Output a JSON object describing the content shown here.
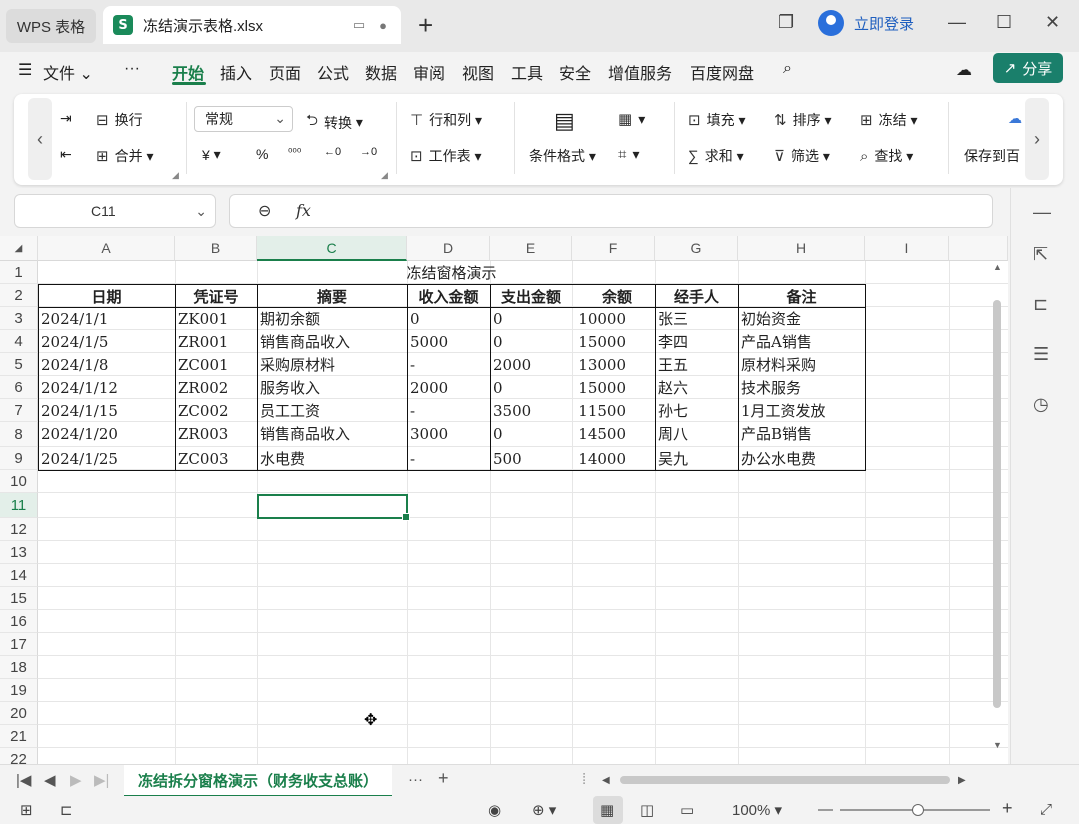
{
  "titlebar": {
    "app_tab": "WPS 表格",
    "file_tab": "冻结演示表格.xlsx",
    "login": "立即登录"
  },
  "menu": {
    "items": [
      "文件",
      "···",
      "开始",
      "插入",
      "页面",
      "公式",
      "数据",
      "审阅",
      "视图",
      "工具",
      "安全",
      "增值服务",
      "百度网盘"
    ],
    "active": "开始",
    "share": "分享"
  },
  "ribbon": {
    "wrap": "换行",
    "merge": "合并",
    "number_format": "常规",
    "convert": "转换",
    "currency": "¥",
    "percent": "%",
    "rows_cols": "行和列",
    "worksheet": "工作表",
    "cond_format": "条件格式",
    "fill": "填充",
    "sort": "排序",
    "freeze": "冻结",
    "sum": "求和",
    "filter": "筛选",
    "find": "查找",
    "save_baidu": "保存到百"
  },
  "formula_bar": {
    "cell_ref": "C11",
    "fx": "fx",
    "value": ""
  },
  "grid": {
    "columns": [
      "A",
      "B",
      "C",
      "D",
      "E",
      "F",
      "G",
      "H",
      "I"
    ],
    "rows": [
      "1",
      "2",
      "3",
      "4",
      "5",
      "6",
      "7",
      "8",
      "9",
      "10",
      "11",
      "12",
      "13",
      "14",
      "15",
      "16",
      "17",
      "18",
      "19",
      "20",
      "21",
      "22"
    ],
    "selected_cell": "C11",
    "title": "冻结窗格演示",
    "headers": [
      "日期",
      "凭证号",
      "摘要",
      "收入金额",
      "支出金额",
      "余额",
      "经手人",
      "备注"
    ],
    "data": [
      [
        "2024/1/1",
        "ZK001",
        "期初余额",
        "0",
        "0",
        "10000",
        "张三",
        "初始资金"
      ],
      [
        "2024/1/5",
        "ZR001",
        "销售商品收入",
        "5000",
        "0",
        "15000",
        "李四",
        "产品A销售"
      ],
      [
        "2024/1/8",
        "ZC001",
        "采购原材料",
        "-",
        "2000",
        "13000",
        "王五",
        "原材料采购"
      ],
      [
        "2024/1/12",
        "ZR002",
        "服务收入",
        "2000",
        "0",
        "15000",
        "赵六",
        "技术服务"
      ],
      [
        "2024/1/15",
        "ZC002",
        "员工工资",
        "-",
        "3500",
        "11500",
        "孙七",
        "1月工资发放"
      ],
      [
        "2024/1/20",
        "ZR003",
        "销售商品收入",
        "3000",
        "0",
        "14500",
        "周八",
        "产品B销售"
      ],
      [
        "2024/1/25",
        "ZC003",
        "水电费",
        "-",
        "500",
        "14000",
        "吴九",
        "办公水电费"
      ]
    ]
  },
  "sheet_tabs": {
    "active": "冻结拆分窗格演示（财务收支总账）"
  },
  "status": {
    "zoom": "100%"
  },
  "colors": {
    "accent": "#1a7f4b",
    "share_bg": "#1a7f6b"
  }
}
